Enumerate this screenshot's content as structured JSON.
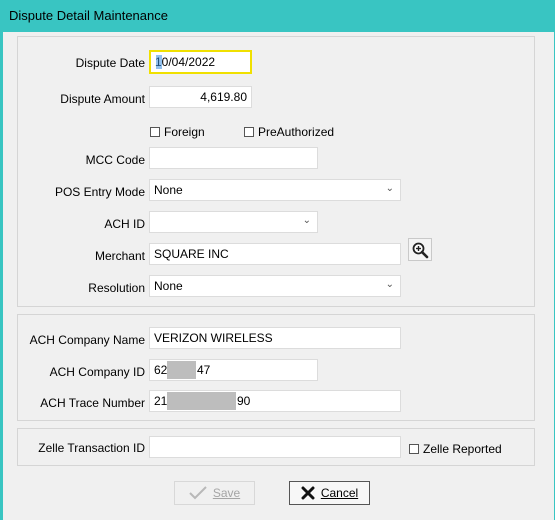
{
  "window": {
    "title": "Dispute Detail Maintenance"
  },
  "dispute": {
    "date_label": "Dispute Date",
    "date_value": "10/04/2022",
    "amount_label": "Dispute Amount",
    "amount_value": "4,619.80",
    "foreign_label": "Foreign",
    "preauthorized_label": "PreAuthorized",
    "mcc_label": "MCC Code",
    "mcc_value": "",
    "pos_label": "POS Entry Mode",
    "pos_value": "None",
    "achid_label": "ACH ID",
    "achid_value": "",
    "merchant_label": "Merchant",
    "merchant_value": "SQUARE INC",
    "merchant_search_icon": "magnifier-plus-icon",
    "resolution_label": "Resolution",
    "resolution_value": "None"
  },
  "ach": {
    "company_name_label": "ACH Company Name",
    "company_name_value": "VERIZON WIRELESS",
    "company_id_label": "ACH Company ID",
    "company_id_prefix": "62",
    "company_id_suffix": "47",
    "trace_label": "ACH Trace Number",
    "trace_prefix": "21",
    "trace_suffix": "90"
  },
  "zelle": {
    "txn_label": "Zelle Transaction ID",
    "txn_value": "",
    "reported_label": "Zelle Reported"
  },
  "buttons": {
    "save_label": "Save",
    "cancel_label": "Cancel"
  },
  "colors": {
    "titlebar": "#39c5c2",
    "client_bg": "#f0f0f0",
    "focus_border": "#f0e000"
  }
}
